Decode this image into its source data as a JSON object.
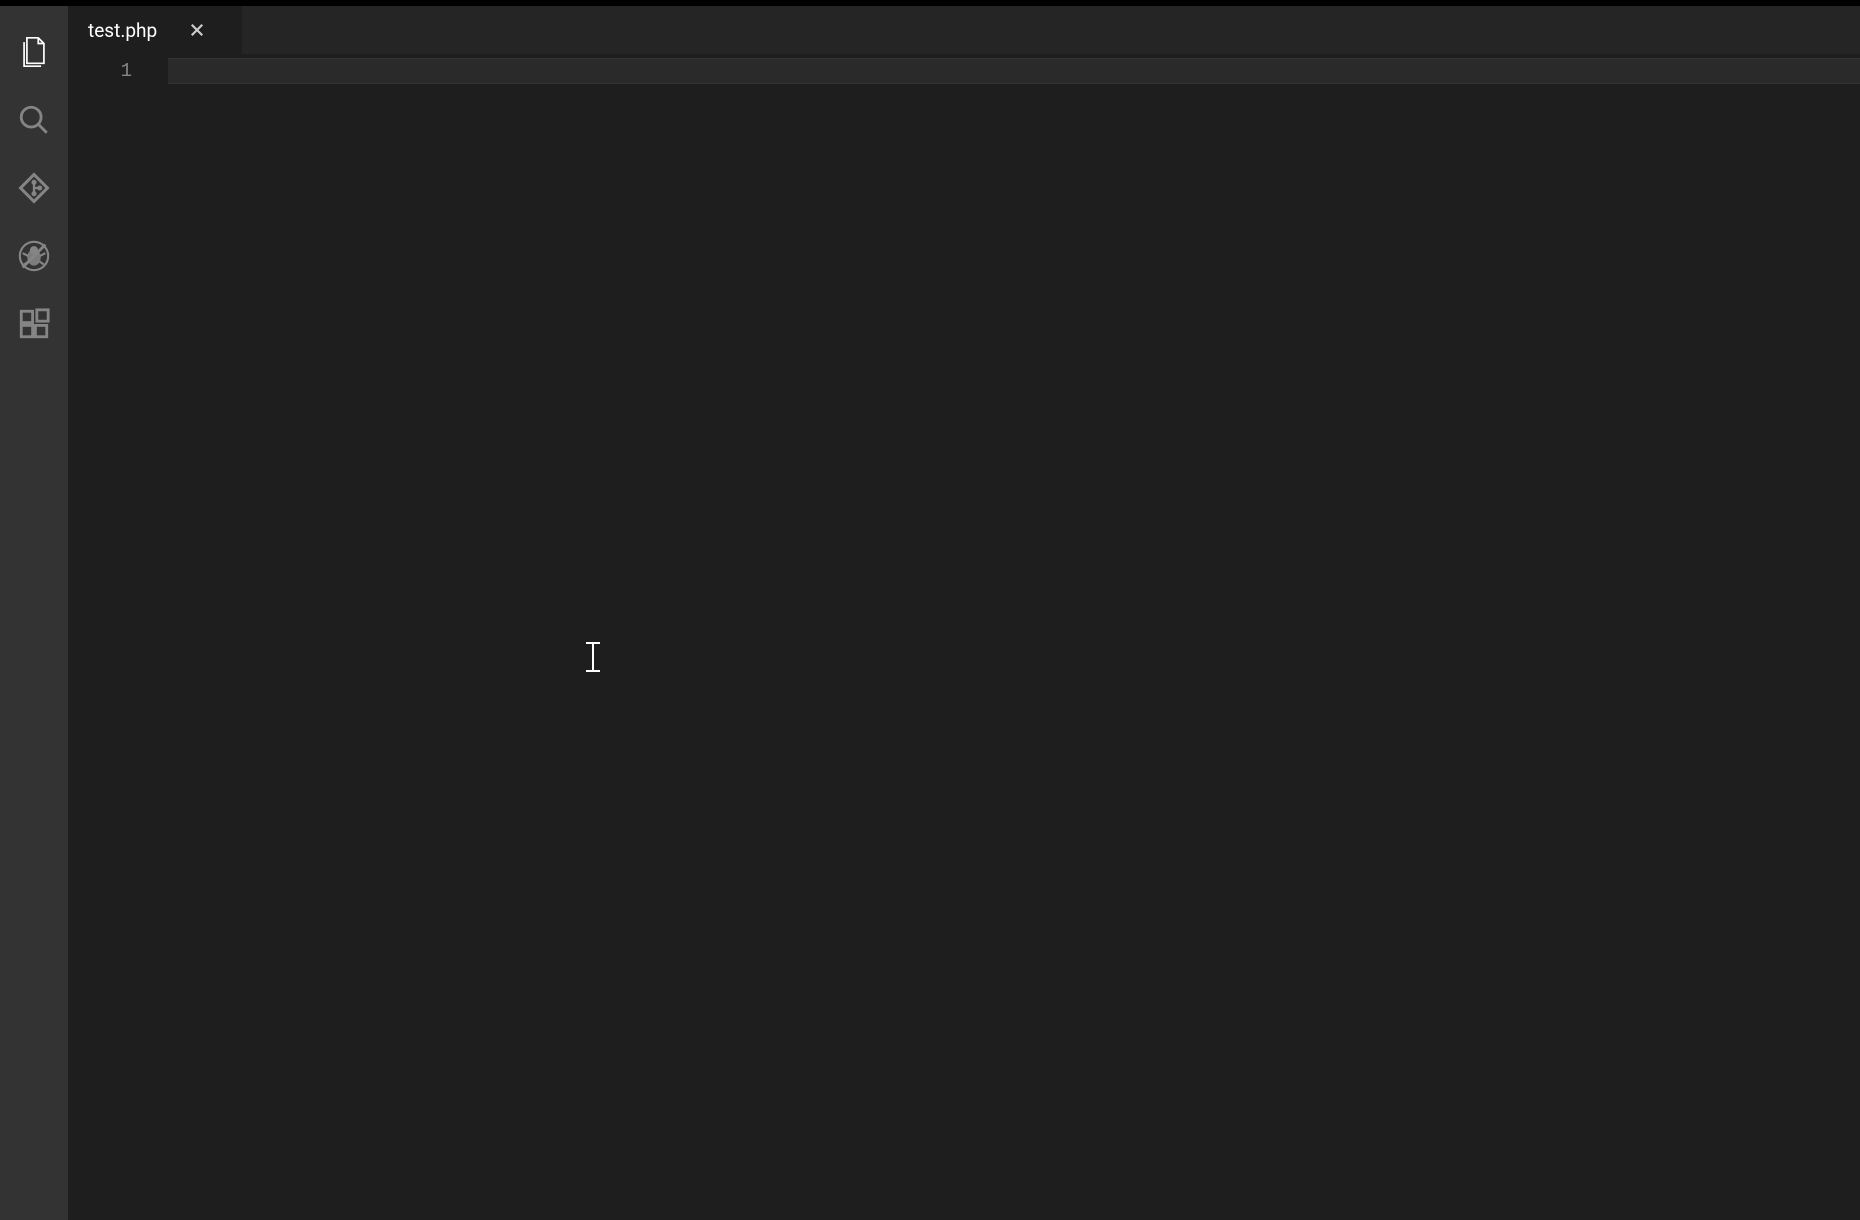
{
  "tabs": [
    {
      "label": "test.php",
      "active": true
    }
  ],
  "activity": {
    "explorer": "explorer",
    "search": "search",
    "scm": "source-control",
    "debug": "debug",
    "extensions": "extensions"
  },
  "editor": {
    "lines": [
      "1"
    ],
    "content": ""
  }
}
